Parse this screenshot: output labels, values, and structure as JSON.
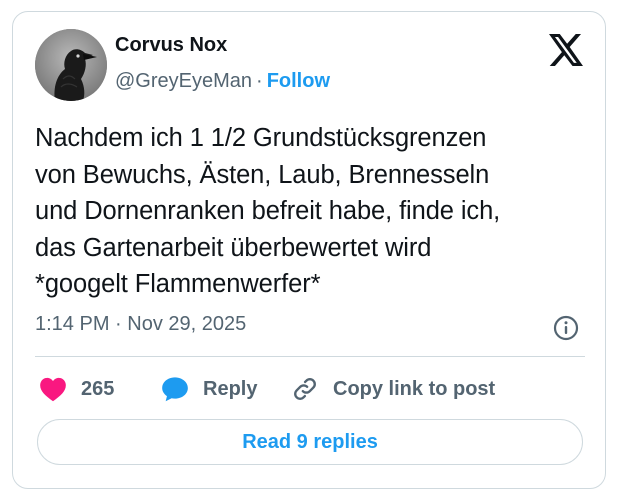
{
  "author": {
    "name": "Corvus Nox",
    "handle": "@GreyEyeMan",
    "separator": "·",
    "follow_label": "Follow",
    "avatar_icon": "raven-avatar"
  },
  "platform_icon": "x-logo-icon",
  "tweet": {
    "lines": [
      "Nachdem ich 1 1/2 Grundstücksgrenzen",
      "von Bewuchs, Ästen, Laub, Brennesseln",
      "und Dornenranken befreit habe, finde ich,",
      "das Gartenarbeit überbewertet wird",
      "*googelt Flammenwerfer*"
    ],
    "timestamp": "1:14 PM · Nov 29, 2025"
  },
  "actions": {
    "like_count": "265",
    "reply_label": "Reply",
    "copy_label": "Copy link to post"
  },
  "read_replies_label": "Read 9 replies",
  "colors": {
    "accent": "#1d9bf0",
    "like": "#f91880",
    "text": "#0f1419",
    "muted": "#536471",
    "border": "#cfd9de"
  }
}
